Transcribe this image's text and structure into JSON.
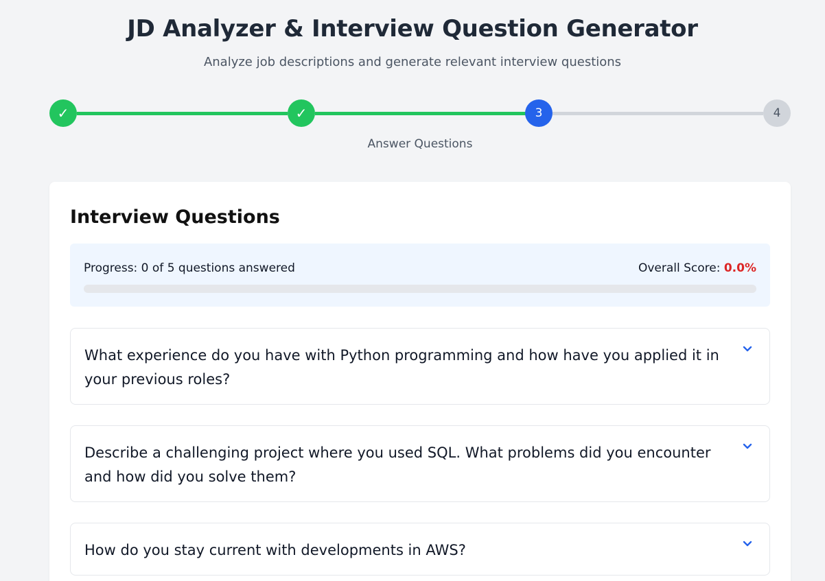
{
  "header": {
    "title": "JD Analyzer & Interview Question Generator",
    "subtitle": "Analyze job descriptions and generate relevant interview questions"
  },
  "stepper": {
    "steps": [
      {
        "label": "✓",
        "state": "done"
      },
      {
        "label": "✓",
        "state": "done"
      },
      {
        "label": "3",
        "state": "current"
      },
      {
        "label": "4",
        "state": "todo"
      }
    ],
    "current_label": "Answer Questions"
  },
  "card": {
    "title": "Interview Questions",
    "progress": {
      "text": "Progress: 0 of 5 questions answered",
      "score_label": "Overall Score:",
      "score_value": "0.0%",
      "fraction": 0
    },
    "questions": [
      {
        "text": "What experience do you have with Python programming and how have you applied it in your previous roles?"
      },
      {
        "text": "Describe a challenging project where you used SQL. What problems did you encounter and how did you solve them?"
      },
      {
        "text": "How do you stay current with developments in AWS?"
      }
    ]
  },
  "colors": {
    "done": "#22c55e",
    "current": "#2563eb",
    "todo": "#d1d5db",
    "score": "#dc2626"
  }
}
